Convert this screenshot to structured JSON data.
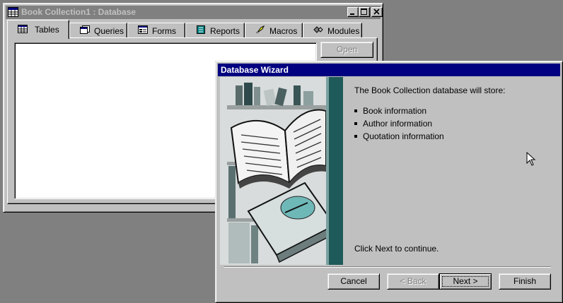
{
  "db_window": {
    "title": "Book Collection1 : Database",
    "tabs": [
      {
        "label": "Tables",
        "icon": "table-icon",
        "active": true
      },
      {
        "label": "Queries",
        "icon": "query-icon"
      },
      {
        "label": "Forms",
        "icon": "form-icon"
      },
      {
        "label": "Reports",
        "icon": "report-icon"
      },
      {
        "label": "Macros",
        "icon": "macro-icon"
      },
      {
        "label": "Modules",
        "icon": "module-icon"
      }
    ],
    "open_label": "Open"
  },
  "wizard": {
    "title": "Database Wizard",
    "intro": "The Book Collection database will store:",
    "items": [
      "Book information",
      "Author information",
      "Quotation information"
    ],
    "footer_text": "Click Next to continue.",
    "buttons": {
      "cancel": "Cancel",
      "back": "< Back",
      "next": "Next >",
      "finish": "Finish"
    }
  },
  "colors": {
    "desktop": "#808080",
    "face": "#c0c0c0",
    "active_title": "#000080",
    "inactive_title": "#808080",
    "teal_stripe": "#1f5a5a"
  }
}
